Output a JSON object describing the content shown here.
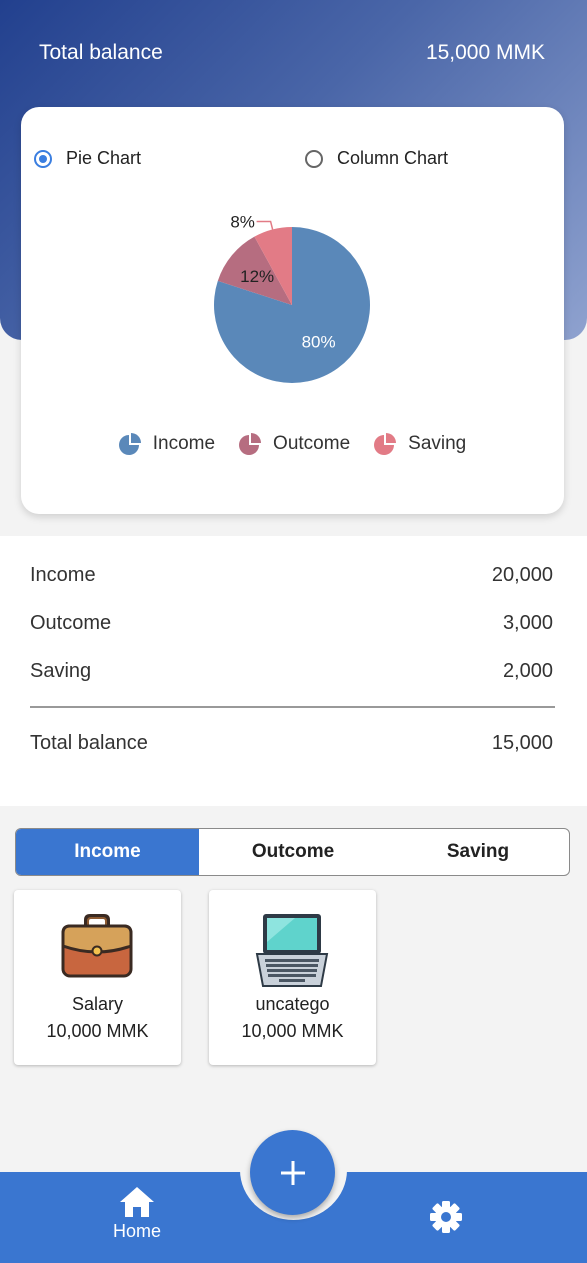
{
  "header": {
    "title": "Total balance",
    "amount": "15,000 MMK"
  },
  "chart_toggle": {
    "pie_label": "Pie Chart",
    "column_label": "Column Chart",
    "selected": "pie"
  },
  "chart_data": {
    "type": "pie",
    "slices": [
      {
        "label": "Income",
        "value": 80,
        "display": "80%",
        "color": "#5a88b9"
      },
      {
        "label": "Outcome",
        "value": 12,
        "display": "12%",
        "color": "#b66d80"
      },
      {
        "label": "Saving",
        "value": 8,
        "display": "8%",
        "color": "#e27b86"
      }
    ],
    "legend": [
      "Income",
      "Outcome",
      "Saving"
    ]
  },
  "summary": {
    "rows": [
      {
        "label": "Income",
        "value": "20,000"
      },
      {
        "label": "Outcome",
        "value": "3,000"
      },
      {
        "label": "Saving",
        "value": "2,000"
      }
    ],
    "total": {
      "label": "Total balance",
      "value": "15,000"
    }
  },
  "tabs": [
    {
      "label": "Income",
      "active": true
    },
    {
      "label": "Outcome",
      "active": false
    },
    {
      "label": "Saving",
      "active": false
    }
  ],
  "categories": [
    {
      "name": "Salary",
      "amount": "10,000 MMK",
      "icon": "briefcase-icon"
    },
    {
      "name": "uncatego",
      "amount": "10,000 MMK",
      "icon": "laptop-icon"
    }
  ],
  "nav": {
    "home_label": "Home",
    "fab_icon": "plus-icon",
    "settings_icon": "gear-icon",
    "color": "#3a76d0"
  }
}
